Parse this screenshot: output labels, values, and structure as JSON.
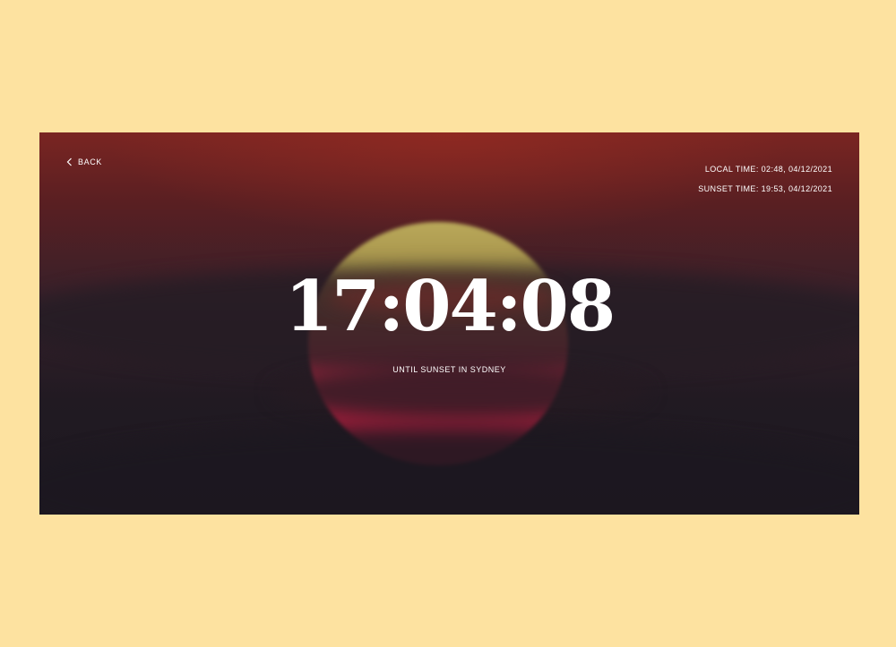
{
  "colors": {
    "page_background": "#fde2a0",
    "text": "#ffffff"
  },
  "nav": {
    "back_label": "BACK",
    "back_icon": "chevron-left-icon"
  },
  "info": {
    "local_time": "LOCAL TIME: 02:48, 04/12/2021",
    "sunset_time": "SUNSET TIME: 19:53, 04/12/2021"
  },
  "countdown": {
    "value": "17:04:08",
    "caption": "UNTIL SUNSET IN SYDNEY"
  }
}
